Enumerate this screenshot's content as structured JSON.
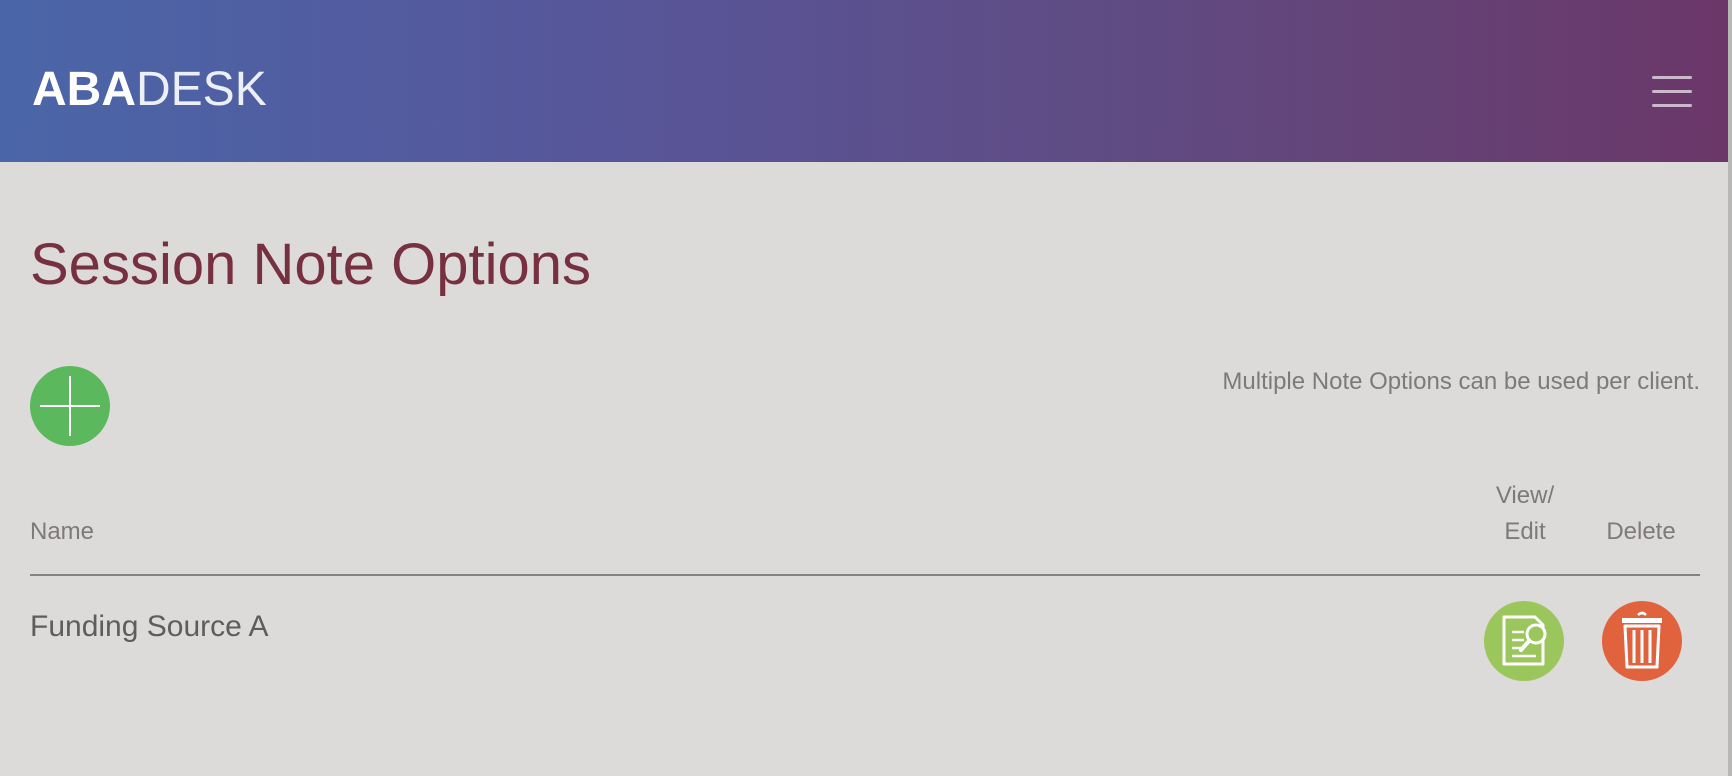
{
  "header": {
    "logo_strong": "ABA",
    "logo_light": "DESK",
    "menu_icon": "hamburger-menu-icon"
  },
  "page": {
    "title": "Session Note Options",
    "add_icon": "plus-icon",
    "helper_text": "Multiple Note Options can be used per client."
  },
  "table": {
    "columns": {
      "name": "Name",
      "view_edit_line1": "View/",
      "view_edit_line2": "Edit",
      "delete": "Delete"
    },
    "rows": [
      {
        "name": "Funding Source A",
        "view_icon": "document-search-icon",
        "delete_icon": "trash-icon"
      }
    ]
  },
  "colors": {
    "title": "#77303f",
    "add_button": "#5cb85c",
    "view_button": "#9bc65c",
    "delete_button": "#e0633e",
    "background": "#dddbda"
  }
}
